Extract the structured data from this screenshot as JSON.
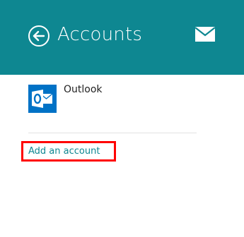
{
  "header": {
    "title": "Accounts",
    "background_color": "#0e8791",
    "back_icon": "back-arrow-circle-icon",
    "mail_icon": "mail-envelope-icon"
  },
  "accounts": [
    {
      "name": "Outlook",
      "icon": "outlook-icon",
      "tile_color": "#0072c6"
    }
  ],
  "add_account": {
    "label": "Add an account",
    "color": "#0e8791"
  },
  "annotation": {
    "highlight_color": "#ff0000"
  }
}
